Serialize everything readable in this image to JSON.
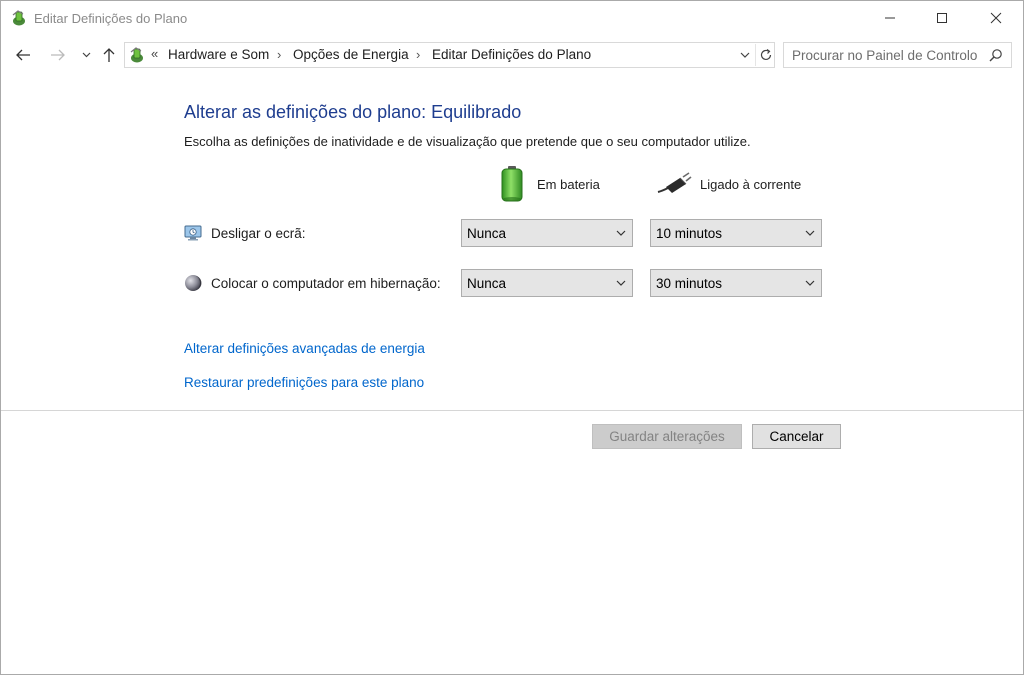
{
  "window": {
    "title": "Editar Definições do Plano"
  },
  "toolbar": {
    "breadcrumbs": [
      "Hardware e Som",
      "Opções de Energia",
      "Editar Definições do Plano"
    ],
    "overflow_glyph": "«",
    "search_placeholder": "Procurar no Painel de Controlo"
  },
  "main": {
    "heading": "Alterar as definições do plano: Equilibrado",
    "description": "Escolha as definições de inatividade e de visualização que pretende que o seu computador utilize.",
    "columns": {
      "battery_label": "Em bateria",
      "plugged_label": "Ligado à corrente"
    },
    "rows": [
      {
        "label": "Desligar o ecrã:",
        "battery_value": "Nunca",
        "plugged_value": "10 minutos"
      },
      {
        "label": "Colocar o computador em hibernação:",
        "battery_value": "Nunca",
        "plugged_value": "30 minutos"
      }
    ],
    "links": {
      "advanced": "Alterar definições avançadas de energia",
      "restore": "Restaurar predefinições para este plano"
    }
  },
  "buttons": {
    "save_label": "Guardar alterações",
    "save_enabled": false,
    "cancel_label": "Cancelar"
  },
  "icons": {
    "app": "power-options-icon",
    "back": "back-arrow-icon",
    "forward": "forward-arrow-icon",
    "recent": "chevron-down-icon",
    "up": "up-arrow-icon",
    "refresh": "refresh-icon",
    "search": "search-icon",
    "battery": "battery-icon",
    "plug": "power-plug-icon",
    "display": "display-off-icon",
    "hibernate": "moon-icon"
  },
  "colors": {
    "heading": "#1e3d8f",
    "link": "#0066cc",
    "battery_green": "#3fae2a"
  }
}
